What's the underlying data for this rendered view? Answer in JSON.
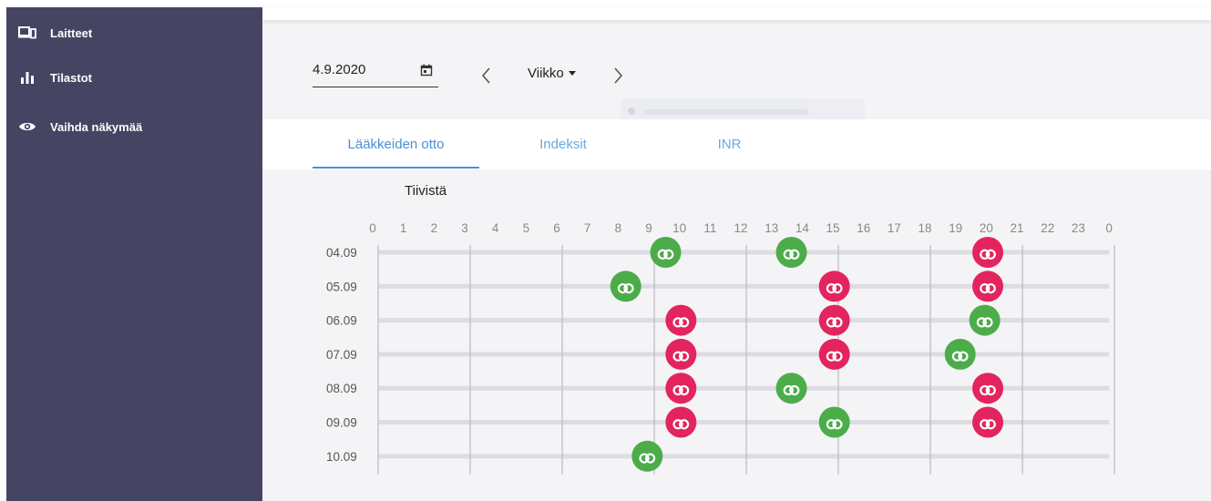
{
  "sidebar": {
    "items": [
      {
        "label": "Laitteet",
        "icon": "devices-icon"
      },
      {
        "label": "Tilastot",
        "icon": "bar-chart-icon"
      },
      {
        "label": "Vaihda näkymää",
        "icon": "eye-icon"
      }
    ]
  },
  "toolbar": {
    "date_value": "4.9.2020",
    "period_label": "Viikko"
  },
  "tabs": [
    {
      "label": "Lääkkeiden otto",
      "active": true
    },
    {
      "label": "Indeksit",
      "active": false
    },
    {
      "label": "INR",
      "active": false
    }
  ],
  "compact_label": "Tiivistä",
  "colors": {
    "taken": "#4cac49",
    "missed": "#e3245e",
    "accent": "#4a90d6",
    "sidebar": "#454563"
  },
  "chart_data": {
    "type": "scatter",
    "x_hours": [
      "0",
      "1",
      "2",
      "3",
      "4",
      "5",
      "6",
      "7",
      "8",
      "9",
      "10",
      "11",
      "12",
      "13",
      "14",
      "15",
      "16",
      "17",
      "18",
      "19",
      "20",
      "21",
      "22",
      "23",
      "0"
    ],
    "y_dates": [
      "04.09",
      "05.09",
      "06.09",
      "07.09",
      "08.09",
      "09.09",
      "10.09"
    ],
    "series": [
      {
        "status": "taken",
        "points": [
          {
            "date": "04.09",
            "hour": 9.4
          },
          {
            "date": "04.09",
            "hour": 13.5
          },
          {
            "date": "05.09",
            "hour": 8.1
          },
          {
            "date": "06.09",
            "hour": 19.8
          },
          {
            "date": "07.09",
            "hour": 19.0
          },
          {
            "date": "08.09",
            "hour": 13.5
          },
          {
            "date": "09.09",
            "hour": 14.9
          },
          {
            "date": "10.09",
            "hour": 8.8
          }
        ]
      },
      {
        "status": "missed",
        "points": [
          {
            "date": "04.09",
            "hour": 19.9
          },
          {
            "date": "05.09",
            "hour": 14.9
          },
          {
            "date": "05.09",
            "hour": 19.9
          },
          {
            "date": "06.09",
            "hour": 9.9
          },
          {
            "date": "06.09",
            "hour": 14.9
          },
          {
            "date": "07.09",
            "hour": 9.9
          },
          {
            "date": "07.09",
            "hour": 14.9
          },
          {
            "date": "08.09",
            "hour": 9.9
          },
          {
            "date": "08.09",
            "hour": 19.9
          },
          {
            "date": "09.09",
            "hour": 9.9
          },
          {
            "date": "09.09",
            "hour": 19.9
          }
        ]
      }
    ],
    "vertical_gridlines_every_hours": 3,
    "ylim": [
      0,
      24
    ]
  }
}
